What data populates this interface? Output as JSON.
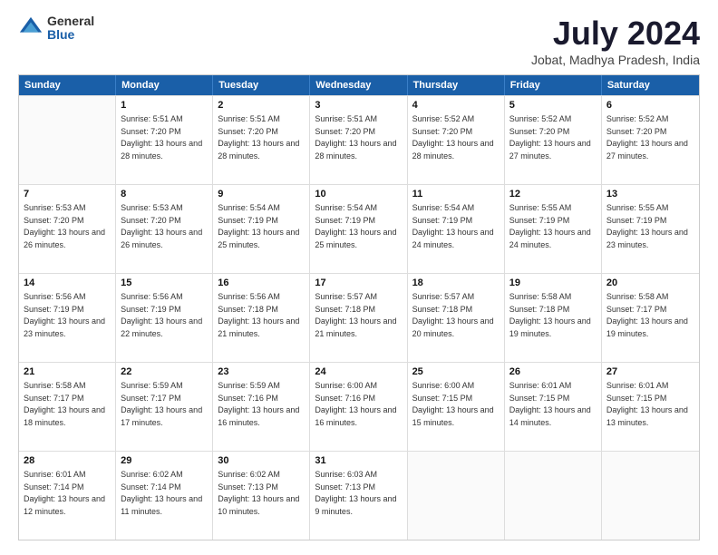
{
  "logo": {
    "general": "General",
    "blue": "Blue"
  },
  "header": {
    "title": "July 2024",
    "subtitle": "Jobat, Madhya Pradesh, India"
  },
  "days": [
    "Sunday",
    "Monday",
    "Tuesday",
    "Wednesday",
    "Thursday",
    "Friday",
    "Saturday"
  ],
  "weeks": [
    [
      {
        "day": "",
        "empty": true
      },
      {
        "day": "1",
        "sunrise": "Sunrise: 5:51 AM",
        "sunset": "Sunset: 7:20 PM",
        "daylight": "Daylight: 13 hours and 28 minutes."
      },
      {
        "day": "2",
        "sunrise": "Sunrise: 5:51 AM",
        "sunset": "Sunset: 7:20 PM",
        "daylight": "Daylight: 13 hours and 28 minutes."
      },
      {
        "day": "3",
        "sunrise": "Sunrise: 5:51 AM",
        "sunset": "Sunset: 7:20 PM",
        "daylight": "Daylight: 13 hours and 28 minutes."
      },
      {
        "day": "4",
        "sunrise": "Sunrise: 5:52 AM",
        "sunset": "Sunset: 7:20 PM",
        "daylight": "Daylight: 13 hours and 28 minutes."
      },
      {
        "day": "5",
        "sunrise": "Sunrise: 5:52 AM",
        "sunset": "Sunset: 7:20 PM",
        "daylight": "Daylight: 13 hours and 27 minutes."
      },
      {
        "day": "6",
        "sunrise": "Sunrise: 5:52 AM",
        "sunset": "Sunset: 7:20 PM",
        "daylight": "Daylight: 13 hours and 27 minutes."
      }
    ],
    [
      {
        "day": "7",
        "sunrise": "Sunrise: 5:53 AM",
        "sunset": "Sunset: 7:20 PM",
        "daylight": "Daylight: 13 hours and 26 minutes."
      },
      {
        "day": "8",
        "sunrise": "Sunrise: 5:53 AM",
        "sunset": "Sunset: 7:20 PM",
        "daylight": "Daylight: 13 hours and 26 minutes."
      },
      {
        "day": "9",
        "sunrise": "Sunrise: 5:54 AM",
        "sunset": "Sunset: 7:19 PM",
        "daylight": "Daylight: 13 hours and 25 minutes."
      },
      {
        "day": "10",
        "sunrise": "Sunrise: 5:54 AM",
        "sunset": "Sunset: 7:19 PM",
        "daylight": "Daylight: 13 hours and 25 minutes."
      },
      {
        "day": "11",
        "sunrise": "Sunrise: 5:54 AM",
        "sunset": "Sunset: 7:19 PM",
        "daylight": "Daylight: 13 hours and 24 minutes."
      },
      {
        "day": "12",
        "sunrise": "Sunrise: 5:55 AM",
        "sunset": "Sunset: 7:19 PM",
        "daylight": "Daylight: 13 hours and 24 minutes."
      },
      {
        "day": "13",
        "sunrise": "Sunrise: 5:55 AM",
        "sunset": "Sunset: 7:19 PM",
        "daylight": "Daylight: 13 hours and 23 minutes."
      }
    ],
    [
      {
        "day": "14",
        "sunrise": "Sunrise: 5:56 AM",
        "sunset": "Sunset: 7:19 PM",
        "daylight": "Daylight: 13 hours and 23 minutes."
      },
      {
        "day": "15",
        "sunrise": "Sunrise: 5:56 AM",
        "sunset": "Sunset: 7:19 PM",
        "daylight": "Daylight: 13 hours and 22 minutes."
      },
      {
        "day": "16",
        "sunrise": "Sunrise: 5:56 AM",
        "sunset": "Sunset: 7:18 PM",
        "daylight": "Daylight: 13 hours and 21 minutes."
      },
      {
        "day": "17",
        "sunrise": "Sunrise: 5:57 AM",
        "sunset": "Sunset: 7:18 PM",
        "daylight": "Daylight: 13 hours and 21 minutes."
      },
      {
        "day": "18",
        "sunrise": "Sunrise: 5:57 AM",
        "sunset": "Sunset: 7:18 PM",
        "daylight": "Daylight: 13 hours and 20 minutes."
      },
      {
        "day": "19",
        "sunrise": "Sunrise: 5:58 AM",
        "sunset": "Sunset: 7:18 PM",
        "daylight": "Daylight: 13 hours and 19 minutes."
      },
      {
        "day": "20",
        "sunrise": "Sunrise: 5:58 AM",
        "sunset": "Sunset: 7:17 PM",
        "daylight": "Daylight: 13 hours and 19 minutes."
      }
    ],
    [
      {
        "day": "21",
        "sunrise": "Sunrise: 5:58 AM",
        "sunset": "Sunset: 7:17 PM",
        "daylight": "Daylight: 13 hours and 18 minutes."
      },
      {
        "day": "22",
        "sunrise": "Sunrise: 5:59 AM",
        "sunset": "Sunset: 7:17 PM",
        "daylight": "Daylight: 13 hours and 17 minutes."
      },
      {
        "day": "23",
        "sunrise": "Sunrise: 5:59 AM",
        "sunset": "Sunset: 7:16 PM",
        "daylight": "Daylight: 13 hours and 16 minutes."
      },
      {
        "day": "24",
        "sunrise": "Sunrise: 6:00 AM",
        "sunset": "Sunset: 7:16 PM",
        "daylight": "Daylight: 13 hours and 16 minutes."
      },
      {
        "day": "25",
        "sunrise": "Sunrise: 6:00 AM",
        "sunset": "Sunset: 7:15 PM",
        "daylight": "Daylight: 13 hours and 15 minutes."
      },
      {
        "day": "26",
        "sunrise": "Sunrise: 6:01 AM",
        "sunset": "Sunset: 7:15 PM",
        "daylight": "Daylight: 13 hours and 14 minutes."
      },
      {
        "day": "27",
        "sunrise": "Sunrise: 6:01 AM",
        "sunset": "Sunset: 7:15 PM",
        "daylight": "Daylight: 13 hours and 13 minutes."
      }
    ],
    [
      {
        "day": "28",
        "sunrise": "Sunrise: 6:01 AM",
        "sunset": "Sunset: 7:14 PM",
        "daylight": "Daylight: 13 hours and 12 minutes."
      },
      {
        "day": "29",
        "sunrise": "Sunrise: 6:02 AM",
        "sunset": "Sunset: 7:14 PM",
        "daylight": "Daylight: 13 hours and 11 minutes."
      },
      {
        "day": "30",
        "sunrise": "Sunrise: 6:02 AM",
        "sunset": "Sunset: 7:13 PM",
        "daylight": "Daylight: 13 hours and 10 minutes."
      },
      {
        "day": "31",
        "sunrise": "Sunrise: 6:03 AM",
        "sunset": "Sunset: 7:13 PM",
        "daylight": "Daylight: 13 hours and 9 minutes."
      },
      {
        "day": "",
        "empty": true
      },
      {
        "day": "",
        "empty": true
      },
      {
        "day": "",
        "empty": true
      }
    ]
  ]
}
